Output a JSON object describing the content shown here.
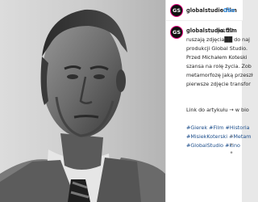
{
  "post": {
    "account": "globalstudio.film",
    "avatar_label": "GS",
    "separator": "•",
    "follow_label": "Obs"
  },
  "caption": {
    "username": "globalstudio.film",
    "lines": [
      "Już 27",
      "ruszają zdjęcia██ do naj",
      "produkcji Global Studio.",
      "Przed Michałem Koteski",
      "szansa na rolę życia. Zob",
      "metamorfozę jaką przeszł",
      "pierwsze zdjęcie transfor",
      "Link do artykułu → w bio",
      "#Gierek #Film #Historia",
      "#MisiekKoterski #Metam",
      "#GlobalStudio #kino"
    ]
  },
  "icons": {
    "avatar": "logo-icon",
    "more": "more-dots-icon"
  },
  "colors": {
    "follow_blue": "#3897f0",
    "hashtag_blue": "#1e4f8c",
    "avatar_ring": "#e6007e"
  }
}
